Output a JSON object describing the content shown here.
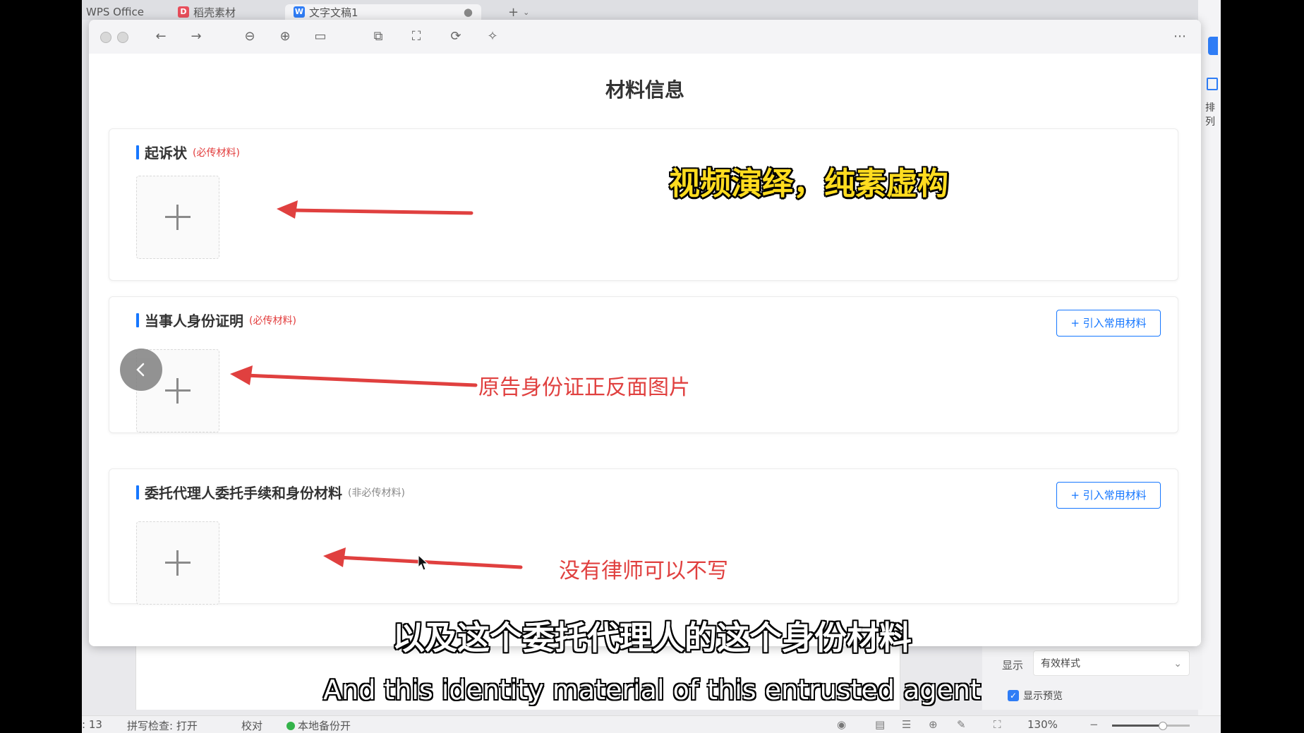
{
  "tabs": [
    {
      "label": "WPS Office",
      "icon": "wps-logo-icon",
      "color": "#e23b3b"
    },
    {
      "label": "稻壳素材",
      "icon": "docer-icon",
      "color": "#e84e5b"
    },
    {
      "label": "文字文稿1",
      "icon": "writer-icon",
      "color": "#2f7df6"
    }
  ],
  "right_panel": {
    "label": "排列"
  },
  "page": {
    "title": "材料信息"
  },
  "cards": [
    {
      "title": "起诉状",
      "tag": "(必传材料)",
      "import_label": ""
    },
    {
      "title": "当事人身份证明",
      "tag": "(必传材料)",
      "import_label": "+ 引入常用材料"
    },
    {
      "title": "委托代理人委托手续和身份材料",
      "tag": "(非必传材料)",
      "import_label": "+ 引入常用材料"
    }
  ],
  "annotations": {
    "watermark": "视频演绎，纯素虚构",
    "id_note": "原告身份证正反面图片",
    "agent_note": "没有律师可以不写"
  },
  "subtitles": {
    "cn": "以及这个委托代理人的这个身份材料",
    "en": "And this identity material of this entrusted agent"
  },
  "style_panel": {
    "display_label": "显示",
    "display_value": "有效样式",
    "preview_label": "显示预览"
  },
  "status_bar": {
    "page_count": ": 13",
    "spell_check": "拼写检查: 打开",
    "proofread": "校对",
    "backup": "本地备份开",
    "zoom": "130%"
  },
  "colors": {
    "accent": "#1677ff",
    "required": "#e23b3b",
    "annotation": "#e0403f",
    "watermark": "#ffdc1f"
  }
}
